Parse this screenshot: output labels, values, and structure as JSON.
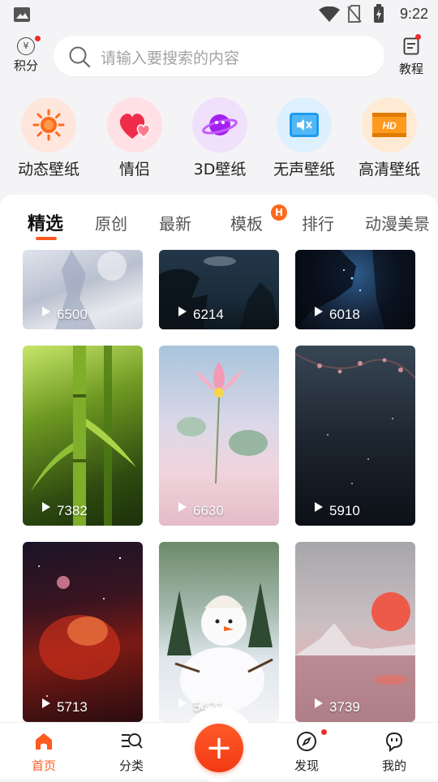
{
  "status_bar": {
    "time": "9:22"
  },
  "header": {
    "points_label": "积分",
    "points_icon_glyph": "¥",
    "search_placeholder": "请输入要搜索的内容",
    "tutorial_label": "教程"
  },
  "categories": [
    {
      "label": "动态壁纸",
      "icon": "sun-icon",
      "color": "#ff6a1f"
    },
    {
      "label": "情侣",
      "icon": "hearts-icon",
      "color": "#ef2d4a"
    },
    {
      "label": "3D壁纸",
      "icon": "planet-icon",
      "color": "#a321f0"
    },
    {
      "label": "无声壁纸",
      "icon": "muted-speaker-icon",
      "color": "#1e9bef"
    },
    {
      "label": "高清壁纸",
      "icon": "hd-film-icon",
      "color": "#ff9a1f",
      "badge": "HD"
    }
  ],
  "tabs": [
    {
      "label": "精选",
      "active": true
    },
    {
      "label": "原创"
    },
    {
      "label": "最新"
    },
    {
      "label": "模板",
      "badge": "H"
    },
    {
      "label": "排行"
    },
    {
      "label": "动漫美景"
    }
  ],
  "cards": [
    {
      "count": "6500",
      "subject": "pale figure"
    },
    {
      "count": "6214",
      "subject": "night sky trees"
    },
    {
      "count": "6018",
      "subject": "starry silhouette"
    },
    {
      "count": "7382",
      "subject": "bamboo"
    },
    {
      "count": "6630",
      "subject": "lotus flower"
    },
    {
      "count": "5910",
      "subject": "night blossoms"
    },
    {
      "count": "5713",
      "subject": "red nebula"
    },
    {
      "count": "5421",
      "subject": "snowman"
    },
    {
      "count": "3739",
      "subject": "pink sunset lake"
    }
  ],
  "bottom_nav": [
    {
      "label": "首页",
      "active": true
    },
    {
      "label": "分类"
    },
    {
      "label": "发现"
    },
    {
      "label": "我的"
    }
  ],
  "fab_symbol": "+",
  "colors": {
    "accent": "#ff5a1f",
    "notification_dot": "#ee2b2b"
  }
}
